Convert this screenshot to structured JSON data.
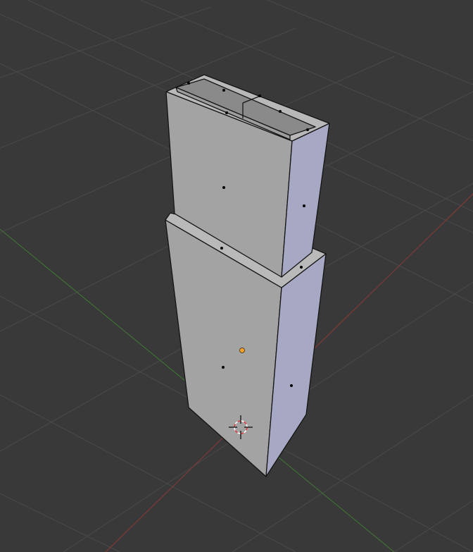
{
  "viewport": {
    "view": "3d-viewport",
    "mode": "edit-mode",
    "object": "mesh"
  },
  "colors": {
    "background": "#393939",
    "grid_line": "#4a4a4a",
    "x_axis": "#8c3a3a",
    "y_axis": "#3f7a34",
    "face_front": "#a3a3a3",
    "face_side": "#a7a9c4",
    "face_top": "#b9b9b9",
    "edge": "#141414",
    "vertex": "#000000",
    "origin": "#f5a02a",
    "cursor_red": "#d23a3a",
    "cursor_white": "#ffffff"
  },
  "icons": {
    "cursor": "3d-cursor-icon",
    "origin": "object-origin-icon"
  }
}
